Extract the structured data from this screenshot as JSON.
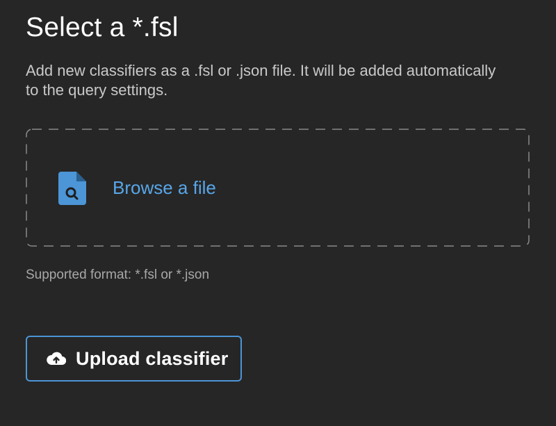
{
  "dialog": {
    "title": "Select a *.fsl",
    "description": "Add new classifiers as a .fsl or .json file. It will be added automatically to the query settings.",
    "dropzone": {
      "icon": "file-search-icon",
      "browse_label": "Browse a file"
    },
    "supported_format": "Supported format: *.fsl or *.json",
    "upload_button": {
      "icon": "cloud-upload-icon",
      "label": "Upload classifier"
    }
  },
  "colors": {
    "background": "#262626",
    "accent": "#58a6e8",
    "button_border": "#4c95d6",
    "text_primary": "#ffffff",
    "text_secondary": "#c9c9c9",
    "dashed_border": "#8a8a8a"
  }
}
